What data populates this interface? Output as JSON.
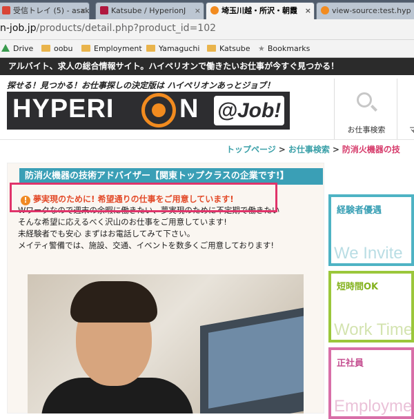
{
  "browser": {
    "tabs": [
      {
        "label": "受信トレイ (5) - asak",
        "color": "#d94537"
      },
      {
        "label": "Katsube / HyperionJ",
        "color": "#b0173f"
      },
      {
        "label": "埼玉川越・所沢・朝霞",
        "color": "#f28b1f"
      },
      {
        "label": "view-source:test.hyp",
        "color": "#f28b1f"
      }
    ],
    "close_glyph": "×",
    "url_prefix": "n-job.jp",
    "url_path": "/products/detail.php?product_id=102",
    "bookmarks": [
      "Drive",
      "oobu",
      "Employment",
      "Yamaguchi",
      "Katsube",
      "Bookmarks"
    ]
  },
  "site": {
    "top_message": "アルバイト、求人の総合情報サイト。ハイペリオンで働きたいお仕事が今すぐ見つかる！",
    "tagline": "探せる！見つかる！お仕事探しの決定版は ハイペリオンあっとジョブ！",
    "logo_left": "HYPERI",
    "logo_right": "N",
    "logo_job": "@Job!",
    "nav_search": "お仕事検索",
    "nav_more": "マ"
  },
  "breadcrumb": {
    "home": "トップページ",
    "search": "お仕事検索",
    "current": "防消火機器の技",
    "sep": ">"
  },
  "job": {
    "title": "防消火機器の技術アドバイザー【関東トップクラスの企業です!】",
    "lead_icon": "!",
    "lead": "夢実現のために! 希望通りの仕事をご用意しています!",
    "body": [
      "Wワークなので週末の余暇に働きたい、夢実現のために不定期で働きたい",
      "そんな希望に応えるべく沢山のお仕事をご用意しています!",
      "未経験者でも安心 まずはお電話してみて下さい。",
      "メイティ警備では、施設、交通、イベントを数多くご用意しております!"
    ]
  },
  "sidebar": [
    {
      "title": "経験者優遇",
      "en": "We Invite"
    },
    {
      "title": "短時間OK",
      "en": "Work Time"
    },
    {
      "title": "正社員",
      "en": "Employmen"
    }
  ]
}
